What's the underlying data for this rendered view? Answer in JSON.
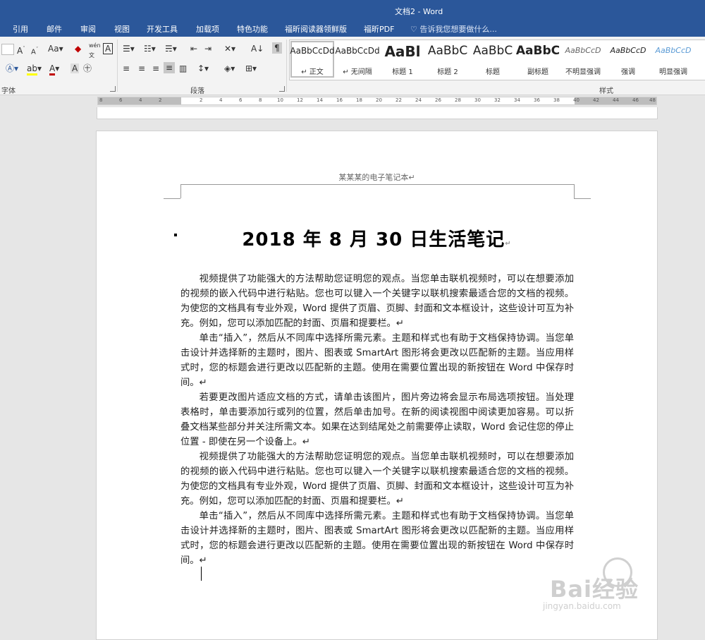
{
  "window": {
    "title": "文档2 - Word"
  },
  "tabs": [
    "引用",
    "邮件",
    "审阅",
    "视图",
    "开发工具",
    "加载项",
    "特色功能",
    "福昕阅读器领鲜版",
    "福昕PDF"
  ],
  "tell_me": "♡ 告诉我您想要做什么...",
  "ribbon": {
    "font_group_label": "字体",
    "paragraph_group_label": "段落",
    "styles_group_label": "样式",
    "styles": [
      {
        "preview": "AaBbCcDd",
        "name": "↵ 正文",
        "selected": true
      },
      {
        "preview": "AaBbCcDd",
        "name": "↵ 无间隔",
        "selected": false
      },
      {
        "preview": "AaBl",
        "name": "标题 1",
        "selected": false
      },
      {
        "preview": "AaBbC",
        "name": "标题 2",
        "selected": false
      },
      {
        "preview": "AaBbC",
        "name": "标题",
        "selected": false
      },
      {
        "preview": "AaBbC",
        "name": "副标题",
        "selected": false
      },
      {
        "preview": "AaBbCcD",
        "name": "不明显强调",
        "selected": false
      },
      {
        "preview": "AaBbCcD",
        "name": "强调",
        "selected": false
      },
      {
        "preview": "AaBbCcD",
        "name": "明显强调",
        "selected": false
      }
    ]
  },
  "ruler": {
    "ticks": [
      "8",
      "6",
      "4",
      "2",
      "2",
      "4",
      "6",
      "8",
      "10",
      "12",
      "14",
      "16",
      "18",
      "20",
      "22",
      "24",
      "26",
      "28",
      "30",
      "32",
      "34",
      "36",
      "38",
      "40",
      "42",
      "44",
      "46",
      "48"
    ]
  },
  "document": {
    "header": "某某某的电子笔记本↵",
    "title": "2018 年 8 月 30 日生活笔记",
    "paragraphs": [
      "视频提供了功能强大的方法帮助您证明您的观点。当您单击联机视频时，可以在想要添加的视频的嵌入代码中进行粘贴。您也可以键入一个关键字以联机搜索最适合您的文档的视频。为使您的文档具有专业外观，Word 提供了页眉、页脚、封面和文本框设计，这些设计可互为补充。例如，您可以添加匹配的封面、页眉和提要栏。↵",
      "单击“插入”，然后从不同库中选择所需元素。主题和样式也有助于文档保持协调。当您单击设计并选择新的主题时，图片、图表或 SmartArt 图形将会更改以匹配新的主题。当应用样式时，您的标题会进行更改以匹配新的主题。使用在需要位置出现的新按钮在 Word 中保存时间。↵",
      "若要更改图片适应文档的方式，请单击该图片，图片旁边将会显示布局选项按钮。当处理表格时，单击要添加行或列的位置，然后单击加号。在新的阅读视图中阅读更加容易。可以折叠文档某些部分并关注所需文本。如果在达到结尾处之前需要停止读取，Word 会记住您的停止位置 - 即使在另一个设备上。↵",
      "视频提供了功能强大的方法帮助您证明您的观点。当您单击联机视频时，可以在想要添加的视频的嵌入代码中进行粘贴。您也可以键入一个关键字以联机搜索最适合您的文档的视频。为使您的文档具有专业外观，Word 提供了页眉、页脚、封面和文本框设计，这些设计可互为补充。例如，您可以添加匹配的封面、页眉和提要栏。↵",
      "单击“插入”，然后从不同库中选择所需元素。主题和样式也有助于文档保持协调。当您单击设计并选择新的主题时，图片、图表或 SmartArt 图形将会更改以匹配新的主题。当应用样式时，您的标题会进行更改以匹配新的主题。使用在需要位置出现的新按钮在 Word 中保存时间。↵"
    ]
  },
  "watermark": {
    "brand": "Bai经验",
    "url": "jingyan.baidu.com"
  },
  "colors": {
    "word_blue": "#2b579a",
    "ribbon_bg": "#f3f3f3",
    "workspace": "#e6e6e6"
  }
}
